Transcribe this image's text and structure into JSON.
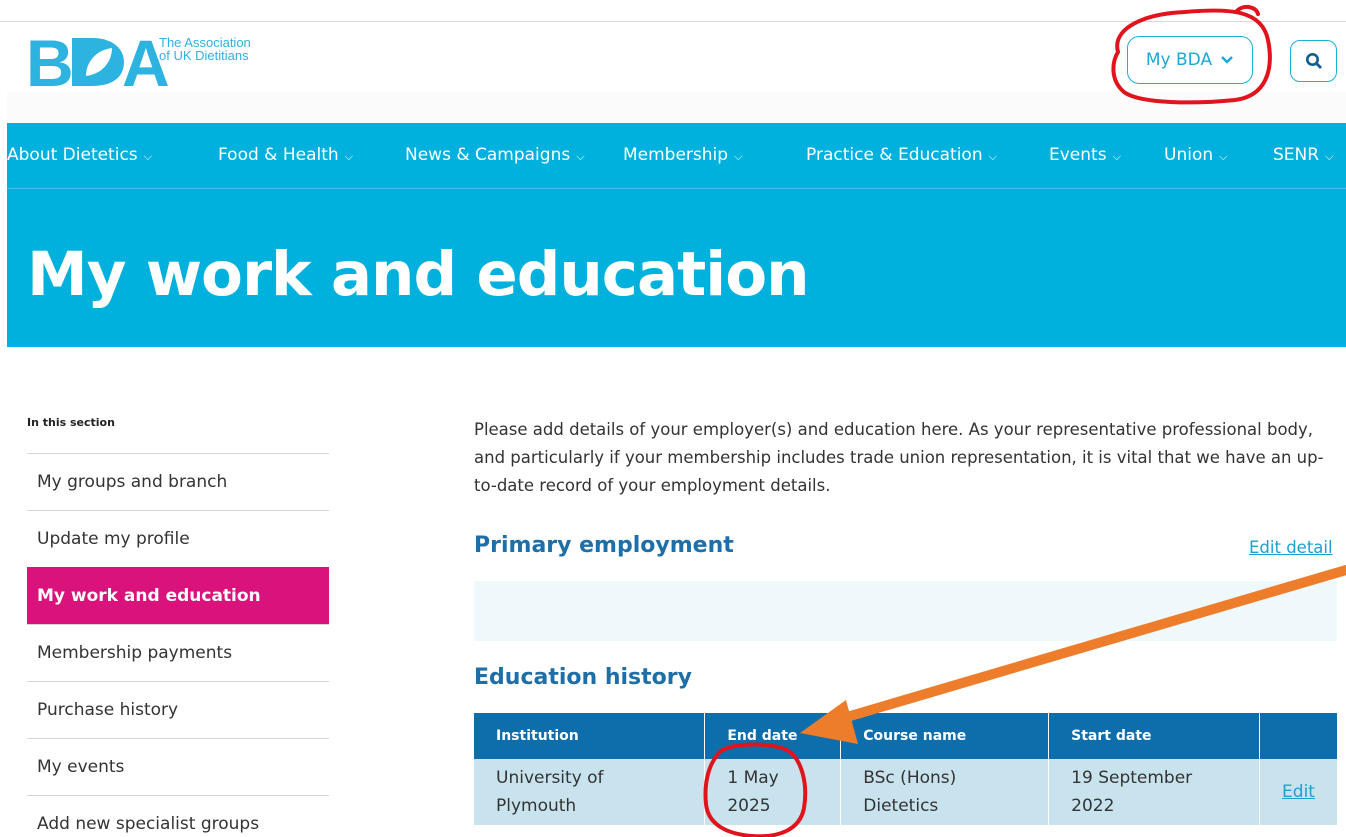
{
  "brand": {
    "logo_letters": "BDA",
    "tagline_1": "The Association",
    "tagline_2": "of UK Dietitians",
    "color": "#2cb3e0"
  },
  "header": {
    "my_bda_label": "My BDA",
    "search_icon": "search-icon"
  },
  "nav": {
    "items": [
      {
        "label": "About Dietetics"
      },
      {
        "label": "Food & Health"
      },
      {
        "label": "News & Campaigns"
      },
      {
        "label": "Membership"
      },
      {
        "label": "Practice & Education"
      },
      {
        "label": "Events"
      },
      {
        "label": "Union"
      },
      {
        "label": "SENR"
      }
    ]
  },
  "page": {
    "title": "My work and education"
  },
  "sidebar": {
    "heading": "In this section",
    "items": [
      {
        "label": "My groups and branch",
        "active": false
      },
      {
        "label": "Update my profile",
        "active": false
      },
      {
        "label": "My work and education",
        "active": true
      },
      {
        "label": "Membership payments",
        "active": false
      },
      {
        "label": "Purchase history",
        "active": false
      },
      {
        "label": "My events",
        "active": false
      },
      {
        "label": "Add new specialist groups",
        "active": false
      }
    ]
  },
  "main": {
    "intro": "Please add details of your employer(s) and education here. As your representative professional body, and particularly if your membership includes trade union representation, it is vital that we have an up-to-date record of your employment details.",
    "primary_heading": "Primary employment",
    "edit_detail": "Edit detail",
    "education_heading": "Education history",
    "table": {
      "headers": [
        "Institution",
        "End date",
        "Course name",
        "Start date",
        ""
      ],
      "rows": [
        {
          "institution": "University of Plymouth",
          "end_date": "1 May 2025",
          "course": "BSc (Hons) Dietetics",
          "start_date": "19 September 2022",
          "action": "Edit"
        }
      ]
    }
  },
  "colors": {
    "primary": "#00b1dd",
    "accent": "#d9127c",
    "table_header": "#0d6eab",
    "annotation_red": "#e0141c",
    "annotation_orange": "#ee7d2b"
  }
}
